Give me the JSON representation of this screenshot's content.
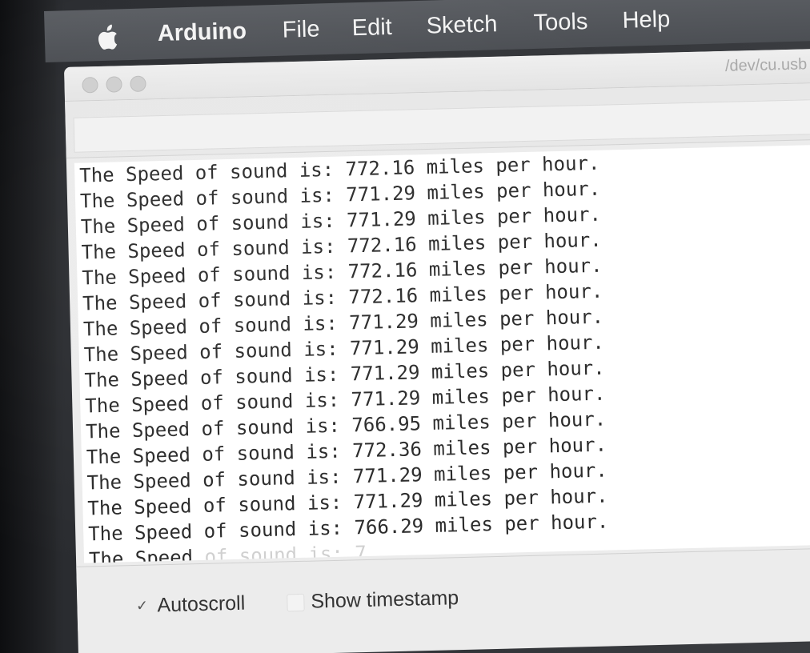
{
  "menubar": {
    "apple_icon": "apple-logo-icon",
    "items": [
      {
        "label": "Arduino"
      },
      {
        "label": "File"
      },
      {
        "label": "Edit"
      },
      {
        "label": "Sketch"
      },
      {
        "label": "Tools"
      },
      {
        "label": "Help"
      }
    ]
  },
  "window": {
    "title": "/dev/cu.usb"
  },
  "serial_output": {
    "lines": [
      "The Speed of sound is: 772.16 miles per hour.",
      "The Speed of sound is: 771.29 miles per hour.",
      "The Speed of sound is: 771.29 miles per hour.",
      "The Speed of sound is: 772.16 miles per hour.",
      "The Speed of sound is: 772.16 miles per hour.",
      "The Speed of sound is: 772.16 miles per hour.",
      "The Speed of sound is: 771.29 miles per hour.",
      "The Speed of sound is: 771.29 miles per hour.",
      "The Speed of sound is: 771.29 miles per hour.",
      "The Speed of sound is: 771.29 miles per hour.",
      "The Speed of sound is: 766.95 miles per hour.",
      "The Speed of sound is: 772.36 miles per hour.",
      "The Speed of sound is: 771.29 miles per hour.",
      "The Speed of sound is: 771.29 miles per hour.",
      "The Speed of sound is: 766.29 miles per hour."
    ],
    "partial_line": {
      "visible": "The Speed",
      "faded": " of sound is: 7"
    }
  },
  "footer": {
    "autoscroll": {
      "label": "Autoscroll",
      "checked": true,
      "check_glyph": "✓"
    },
    "show_timestamp": {
      "label": "Show timestamp",
      "checked": false
    }
  }
}
